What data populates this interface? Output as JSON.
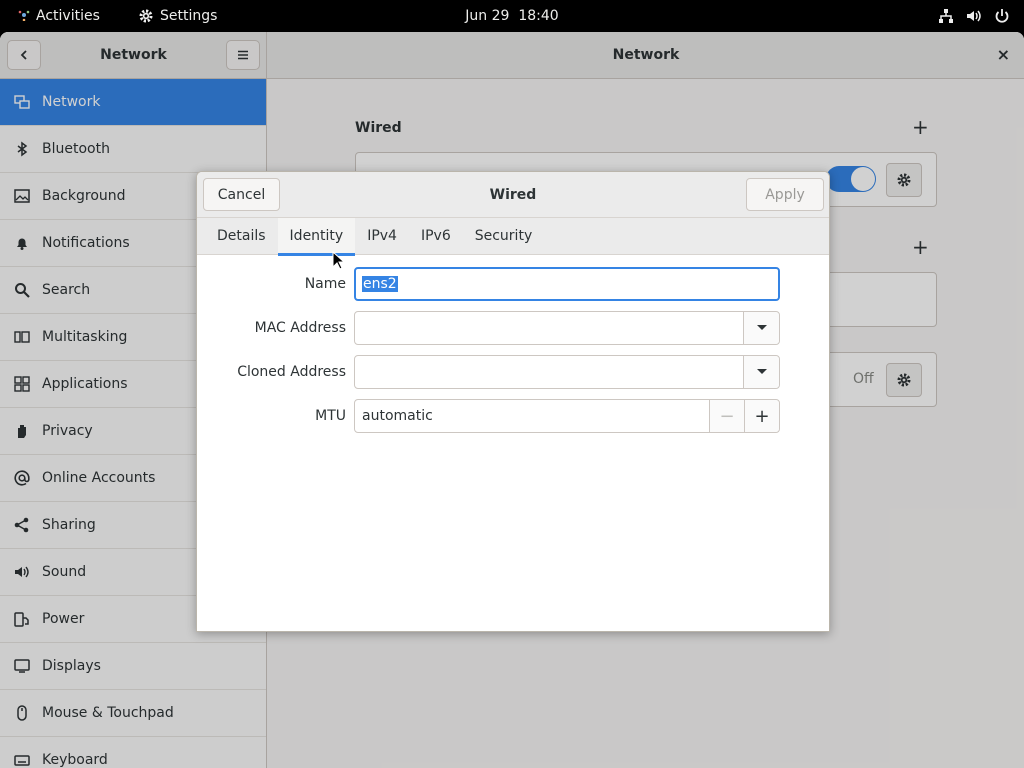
{
  "topbar": {
    "activities": "Activities",
    "app_name": "Settings",
    "clock": "Jun 29  18:40"
  },
  "header": {
    "sidebar_title": "Network",
    "main_title": "Network"
  },
  "sidebar": {
    "items": [
      {
        "label": "Network",
        "icon": "network-icon"
      },
      {
        "label": "Bluetooth",
        "icon": "bluetooth-icon"
      },
      {
        "label": "Background",
        "icon": "background-icon"
      },
      {
        "label": "Notifications",
        "icon": "bell-icon"
      },
      {
        "label": "Search",
        "icon": "search-icon"
      },
      {
        "label": "Multitasking",
        "icon": "multitasking-icon"
      },
      {
        "label": "Applications",
        "icon": "grid-icon"
      },
      {
        "label": "Privacy",
        "icon": "hand-icon"
      },
      {
        "label": "Online Accounts",
        "icon": "at-icon"
      },
      {
        "label": "Sharing",
        "icon": "share-icon"
      },
      {
        "label": "Sound",
        "icon": "speaker-icon"
      },
      {
        "label": "Power",
        "icon": "power-plug-icon"
      },
      {
        "label": "Displays",
        "icon": "display-icon"
      },
      {
        "label": "Mouse & Touchpad",
        "icon": "mouse-icon"
      },
      {
        "label": "Keyboard",
        "icon": "keyboard-icon"
      }
    ]
  },
  "main": {
    "wired_title": "Wired",
    "vpn_off_label": "Off"
  },
  "dialog": {
    "title": "Wired",
    "cancel_label": "Cancel",
    "apply_label": "Apply",
    "tabs": [
      {
        "label": "Details"
      },
      {
        "label": "Identity"
      },
      {
        "label": "IPv4"
      },
      {
        "label": "IPv6"
      },
      {
        "label": "Security"
      }
    ],
    "active_tab": "Identity",
    "fields": {
      "name_label": "Name",
      "name_value": "ens2",
      "mac_label": "MAC Address",
      "mac_value": "",
      "cloned_label": "Cloned Address",
      "cloned_value": "",
      "mtu_label": "MTU",
      "mtu_value": "automatic",
      "mtu_minus": "−",
      "mtu_plus": "+"
    }
  },
  "colors": {
    "accent": "#3584e4",
    "topbar": "#000000"
  }
}
